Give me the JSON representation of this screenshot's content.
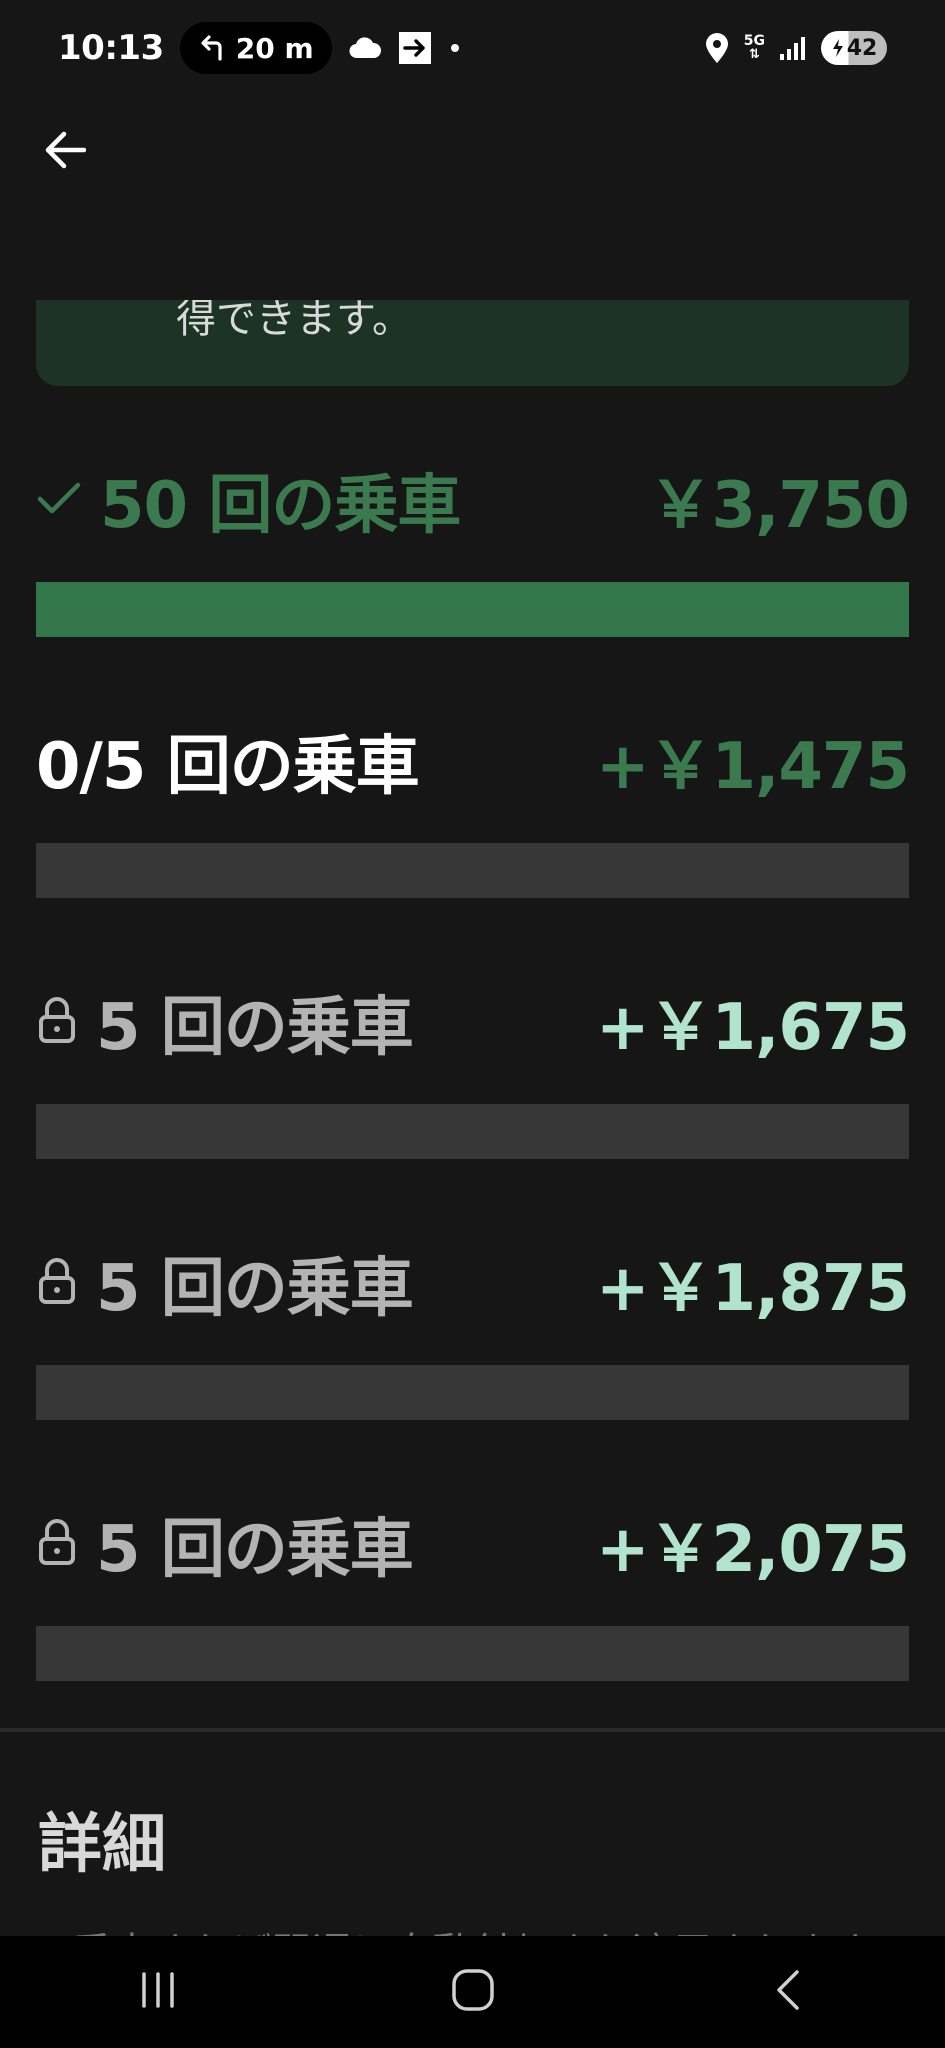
{
  "status_bar": {
    "time": "10:13",
    "nav_pill_text": "20 m",
    "battery": "42",
    "network": "5G",
    "icons": [
      "turn-left-icon",
      "cloud-icon",
      "cast-icon",
      "dot-icon",
      "location-icon",
      "signal-icon",
      "battery-charging-icon"
    ]
  },
  "header": {
    "back_icon": "arrow-left-icon"
  },
  "info_card": {
    "text": "得できます。"
  },
  "tiers": [
    {
      "label": "50 回の乗車",
      "amount": "￥3,750",
      "state": "completed",
      "icon": "check-icon",
      "progress": 1.0
    },
    {
      "label": "0/5 回の乗車",
      "amount": "+￥1,475",
      "state": "active",
      "icon": null,
      "progress": 0.0
    },
    {
      "label": "5 回の乗車",
      "amount": "+￥1,675",
      "state": "locked",
      "icon": "lock-icon",
      "progress": 0.0
    },
    {
      "label": "5 回の乗車",
      "amount": "+￥1,875",
      "state": "locked",
      "icon": "lock-icon",
      "progress": 0.0
    },
    {
      "label": "5 回の乗車",
      "amount": "+￥2,075",
      "state": "locked",
      "icon": "lock-icon",
      "progress": 0.0
    }
  ],
  "details": {
    "title": "詳細",
    "text": "乗車すれば翌週に自動付与され適用されます"
  },
  "colors": {
    "background": "#161616",
    "completed_green": "#3b7a4f",
    "bar_fill": "#33774a",
    "bar_empty": "#373737",
    "locked_amount": "#b2e3cf",
    "info_card_bg": "#1c3326"
  },
  "nav_bar": {
    "icons": [
      "recent-apps-icon",
      "home-icon",
      "back-icon"
    ]
  }
}
